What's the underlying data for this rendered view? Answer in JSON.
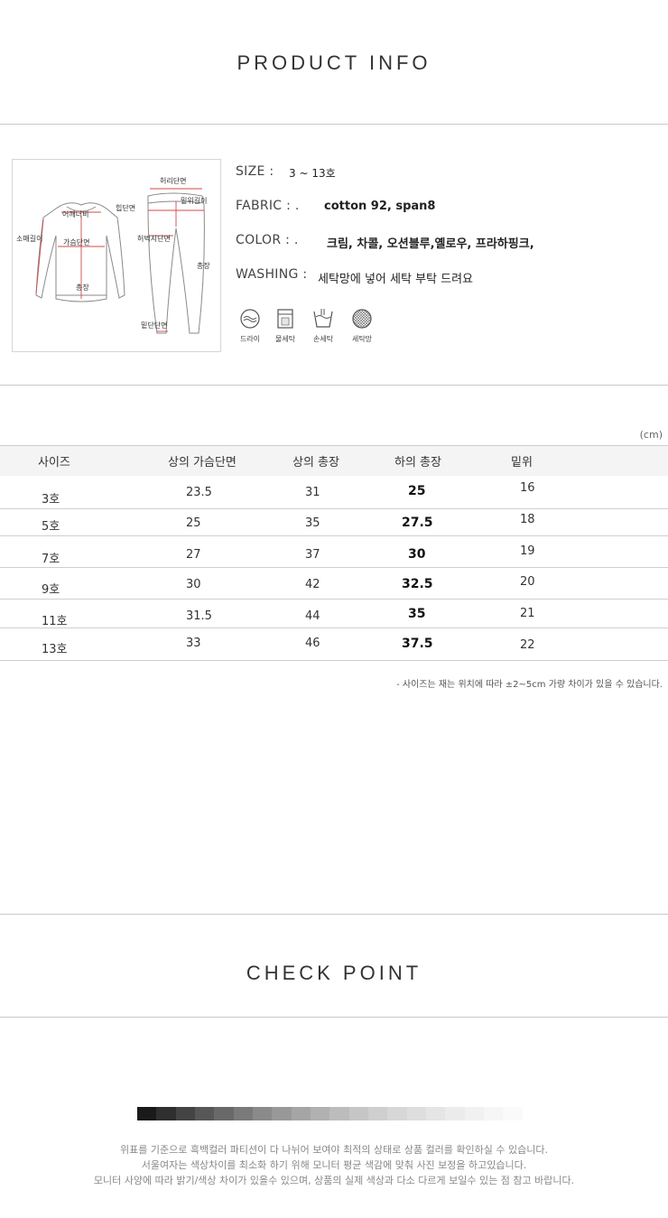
{
  "product_info": {
    "title": "PRODUCT INFO",
    "diagram": {
      "top_labels": {
        "shoulder": "어깨너비",
        "sleeve_length": "소매길이",
        "chest": "가슴단면",
        "hem": "총장"
      },
      "bottom_labels": {
        "waist": "허리단면",
        "rise": "밑위길이",
        "hip": "힙단면",
        "thigh": "허벅지단면",
        "length": "총장",
        "hem": "밑단단면"
      }
    },
    "info": {
      "size_key": "SIZE :",
      "size_val": "3 ~  13호",
      "fabric_key": "FABRIC : .",
      "fabric_val": "cotton 92, span8",
      "color_key": "COLOR  : .",
      "color_val": "크림, 차콜, 오션블루,옐로우, 프라하핑크,",
      "washing_key": "WASHING :",
      "washing_val": "세탁망에 넣어 세탁 부탁 드려요"
    },
    "washing_icons": [
      {
        "icon": "dry-clean-icon",
        "label": "드라이"
      },
      {
        "icon": "water-wash-icon",
        "label": "물세탁"
      },
      {
        "icon": "hand-wash-icon",
        "label": "손세탁"
      },
      {
        "icon": "laundry-net-icon",
        "label": "세탁망"
      }
    ]
  },
  "size_table": {
    "unit": "(cm)",
    "headers": [
      "사이즈",
      "상의 가슴단면",
      "상의 총장",
      "하의 총장",
      "밑위"
    ],
    "rows": [
      [
        "3호",
        "23.5",
        "31",
        "25",
        "16"
      ],
      [
        "5호",
        "25",
        "35",
        "27.5",
        "18"
      ],
      [
        "7호",
        "27",
        "37",
        "30",
        "19"
      ],
      [
        "9호",
        "30",
        "42",
        "32.5",
        "20"
      ],
      [
        "11호",
        "31.5",
        "44",
        "35",
        "21"
      ],
      [
        "13호",
        "33",
        "46",
        "37.5",
        "22"
      ]
    ],
    "note": "- 사이즈는 재는 위치에 따라 ±2~5cm 가량 차이가 있을 수 있습니다."
  },
  "check_point": {
    "title": "CHECK POINT",
    "lines": [
      "위표를 기준으로 흑백컬러 파티션이 다 나뉘어 보여야 최적의 상태로 상품 컬러를 확인하실 수 있습니다.",
      "서울여자는 색상차이를 최소화 하기 위해 모니터 평균 색감에 맞춰 사진 보정을 하고있습니다.",
      "모니터 사양에 따라 밝기/색상 차이가 있을수 있으며, 상품의 실제 색상과 다소 다르게 보일수 있는 점 참고 바랍니다."
    ]
  }
}
